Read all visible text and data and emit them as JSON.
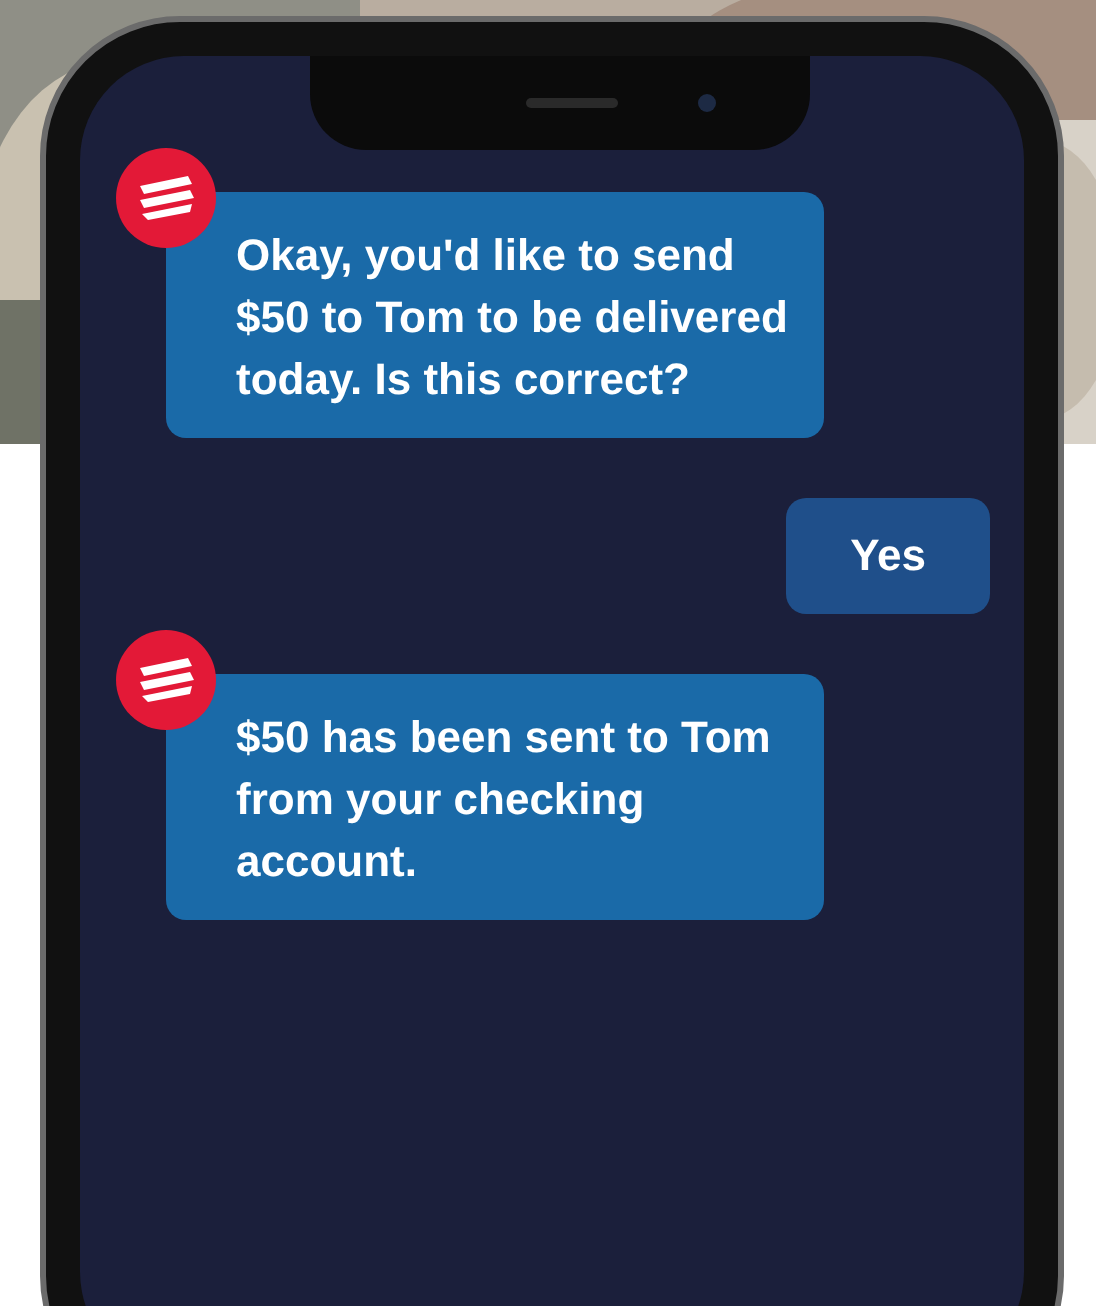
{
  "messages": [
    {
      "kind": "bot",
      "text": "Okay, you'd like to send $50 to Tom to be delivered today. Is this correct?"
    },
    {
      "kind": "user",
      "text": "Yes"
    },
    {
      "kind": "bot",
      "text": "$50 has been sent to Tom from your checking account."
    }
  ]
}
